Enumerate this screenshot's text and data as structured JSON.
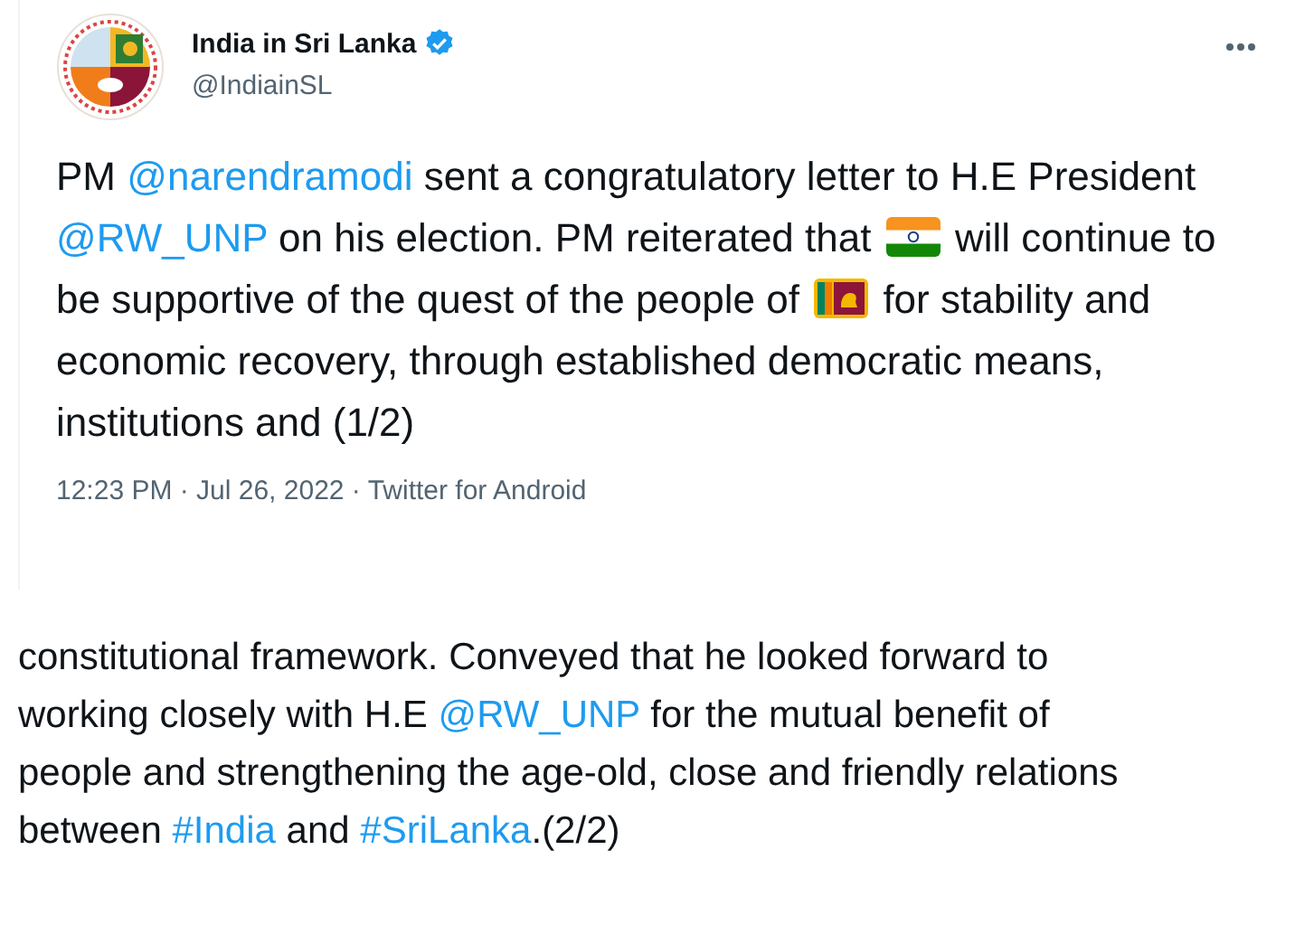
{
  "tweet": {
    "author": {
      "name": "India in Sri Lanka",
      "handle": "@IndiainSL",
      "verified": true
    },
    "text": [
      {
        "kind": "text",
        "text": "PM "
      },
      {
        "kind": "mention",
        "text": "@narendramodi"
      },
      {
        "kind": "text",
        "text": " sent a congratulatory letter to H.E President "
      },
      {
        "kind": "mention",
        "text": "@RW_UNP"
      },
      {
        "kind": "text",
        "text": " on his election. PM reiterated that "
      },
      {
        "kind": "indiaflag"
      },
      {
        "kind": "text",
        "text": " will continue to be supportive of the quest of the people of "
      },
      {
        "kind": "lankaflag"
      },
      {
        "kind": "text",
        "text": " for stability and economic recovery, through established democratic means, institutions and (1/2)"
      }
    ],
    "meta": "12:23 PM · Jul 26, 2022 · Twitter for Android"
  },
  "reply": {
    "text": [
      {
        "kind": "text",
        "text": "constitutional framework. Conveyed that he looked forward to working closely with H.E "
      },
      {
        "kind": "mention",
        "text": "@RW_UNP"
      },
      {
        "kind": "text",
        "text": " for the mutual benefit of people and strengthening the age-old, close and friendly relations between "
      },
      {
        "kind": "hashtag",
        "text": "#India"
      },
      {
        "kind": "text",
        "text": " and "
      },
      {
        "kind": "hashtag",
        "text": "#SriLanka"
      },
      {
        "kind": "text",
        "text": ".(2/2)"
      }
    ]
  }
}
